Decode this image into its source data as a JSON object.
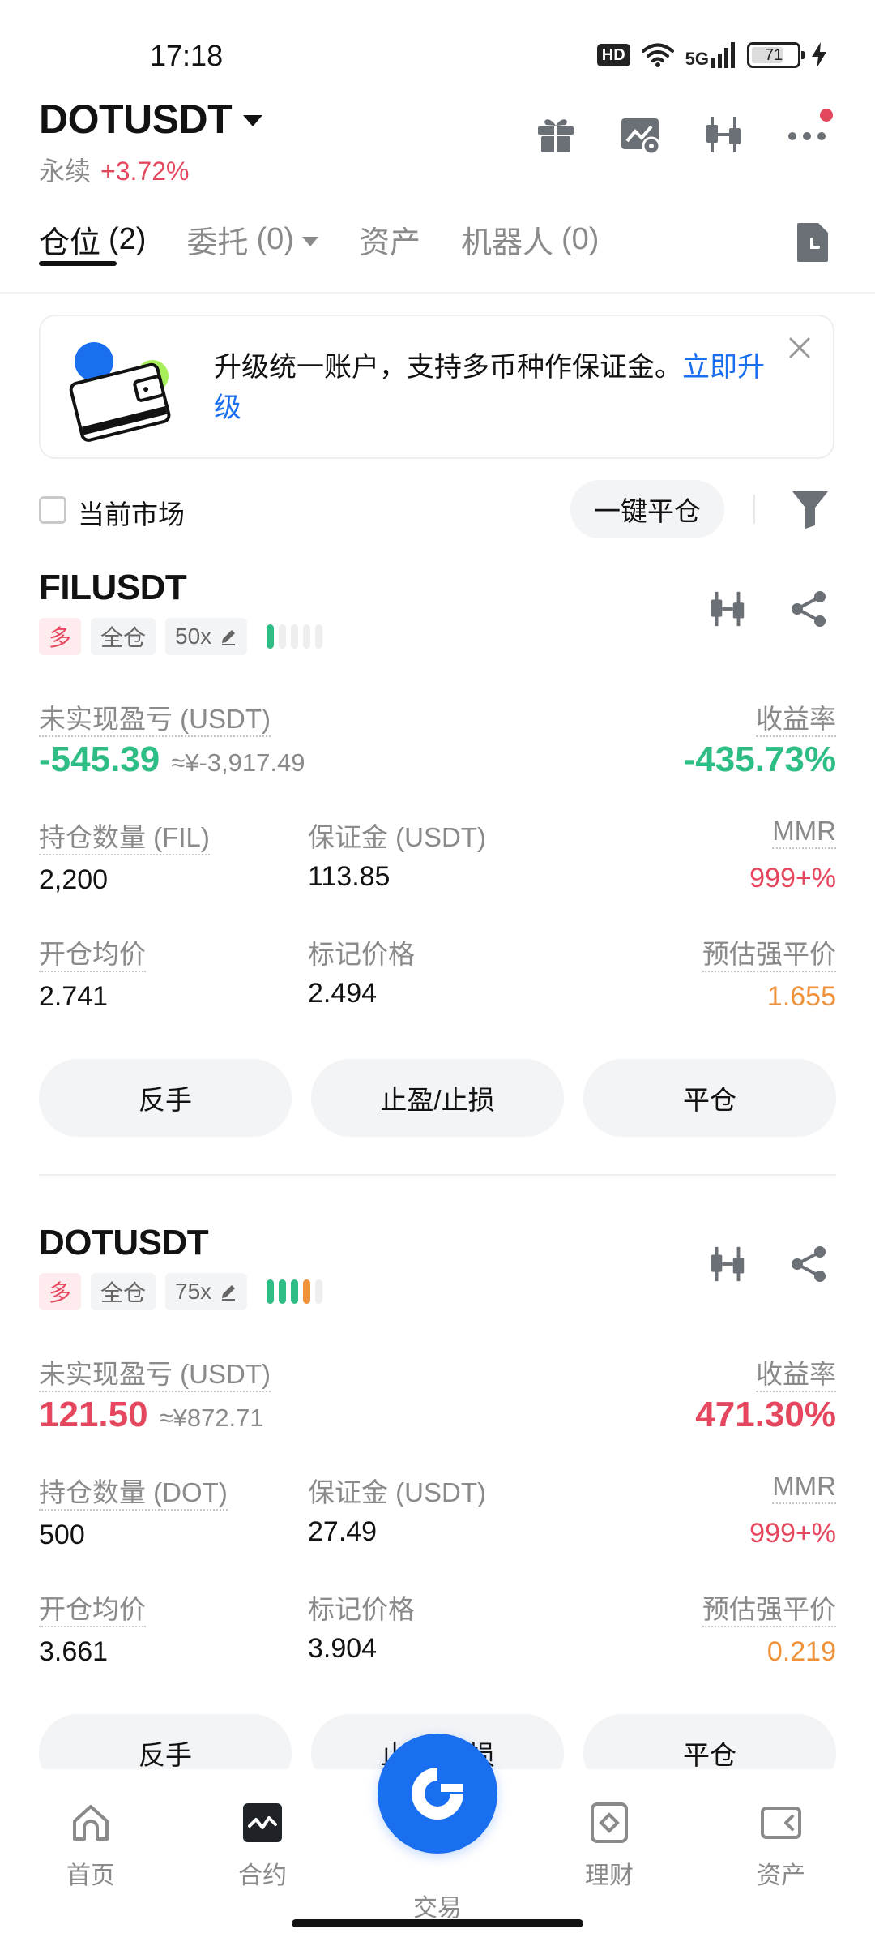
{
  "status": {
    "time": "17:18",
    "hd": "HD",
    "network": "5G",
    "battery": "71",
    "battery_level": 0.71
  },
  "header": {
    "symbol": "DOTUSDT",
    "contract_type": "永续",
    "change": "+3.72%",
    "icons": [
      "gift-icon",
      "chart-settings-icon",
      "candlestick-icon",
      "more-icon"
    ]
  },
  "tabs": [
    {
      "label": "仓位",
      "count": "(2)"
    },
    {
      "label": "委托",
      "count": "(0)"
    },
    {
      "label": "资产",
      "count": ""
    },
    {
      "label": "机器人",
      "count": "(0)"
    }
  ],
  "banner": {
    "text": "升级统一账户，支持多币种作保证金。",
    "link": "立即升级"
  },
  "filter": {
    "current_market_label": "当前市场",
    "close_all_label": "一键平仓"
  },
  "positions": [
    {
      "symbol": "FILUSDT",
      "side": "多",
      "margin_mode": "全仓",
      "leverage": "50x",
      "risk_level": 1,
      "pnl_label": "未实现盈亏 (USDT)",
      "pnl": "-545.39",
      "pnl_cny": "≈¥-3,917.49",
      "roe_label": "收益率",
      "roe": "-435.73%",
      "qty_label": "持仓数量 (FIL)",
      "qty": "2,200",
      "margin_label": "保证金 (USDT)",
      "margin": "113.85",
      "mmr_label": "MMR",
      "mmr": "999+%",
      "entry_label": "开仓均价",
      "entry": "2.741",
      "mark_label": "标记价格",
      "mark": "2.494",
      "liq_label": "预估强平价",
      "liq": "1.655",
      "pnl_color": "#2ebd85"
    },
    {
      "symbol": "DOTUSDT",
      "side": "多",
      "margin_mode": "全仓",
      "leverage": "75x",
      "risk_level": 4,
      "pnl_label": "未实现盈亏 (USDT)",
      "pnl": "121.50",
      "pnl_cny": "≈¥872.71",
      "roe_label": "收益率",
      "roe": "471.30%",
      "qty_label": "持仓数量 (DOT)",
      "qty": "500",
      "margin_label": "保证金 (USDT)",
      "margin": "27.49",
      "mmr_label": "MMR",
      "mmr": "999+%",
      "entry_label": "开仓均价",
      "entry": "3.661",
      "mark_label": "标记价格",
      "mark": "3.904",
      "liq_label": "预估强平价",
      "liq": "0.219",
      "pnl_color": "#e5475e"
    }
  ],
  "actions": {
    "reverse": "反手",
    "tpsl": "止盈/止损",
    "close": "平仓"
  },
  "bottom_nav": [
    {
      "label": "首页",
      "icon": "home-icon"
    },
    {
      "label": "合约",
      "icon": "futures-icon"
    },
    {
      "label": "交易",
      "icon": "trade-icon"
    },
    {
      "label": "理财",
      "icon": "earn-icon"
    },
    {
      "label": "资产",
      "icon": "wallet-icon"
    }
  ],
  "colors": {
    "up": "#e5475e",
    "down": "#2ebd85",
    "accent": "#1a6ff0",
    "liq": "#f0923a"
  }
}
